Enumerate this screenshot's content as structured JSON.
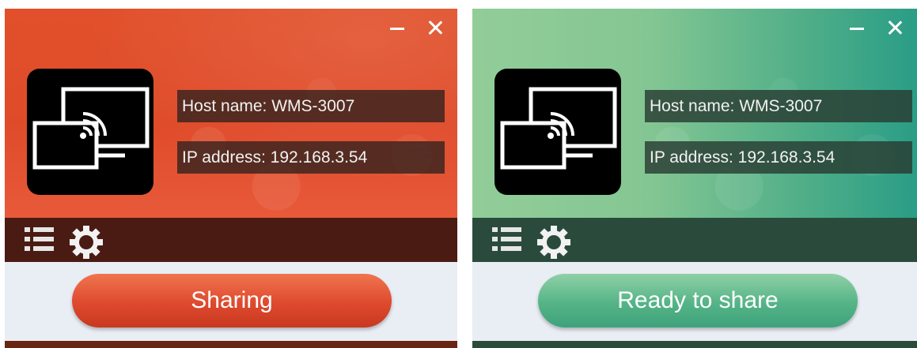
{
  "panels": [
    {
      "state": "sharing",
      "host_name": "Host name: WMS-3007",
      "ip_address": "IP address: 192.168.3.54",
      "action_label": "Sharing",
      "accent": "#df4b2a"
    },
    {
      "state": "ready",
      "host_name": "Host name: WMS-3007",
      "ip_address": "IP address: 192.168.3.54",
      "action_label": "Ready to share",
      "accent": "#4fae88"
    }
  ],
  "icons": {
    "minimize": "minimize-icon",
    "close": "close-icon",
    "logo": "screen-cast-icon",
    "list": "list-icon",
    "settings": "gear-icon"
  }
}
